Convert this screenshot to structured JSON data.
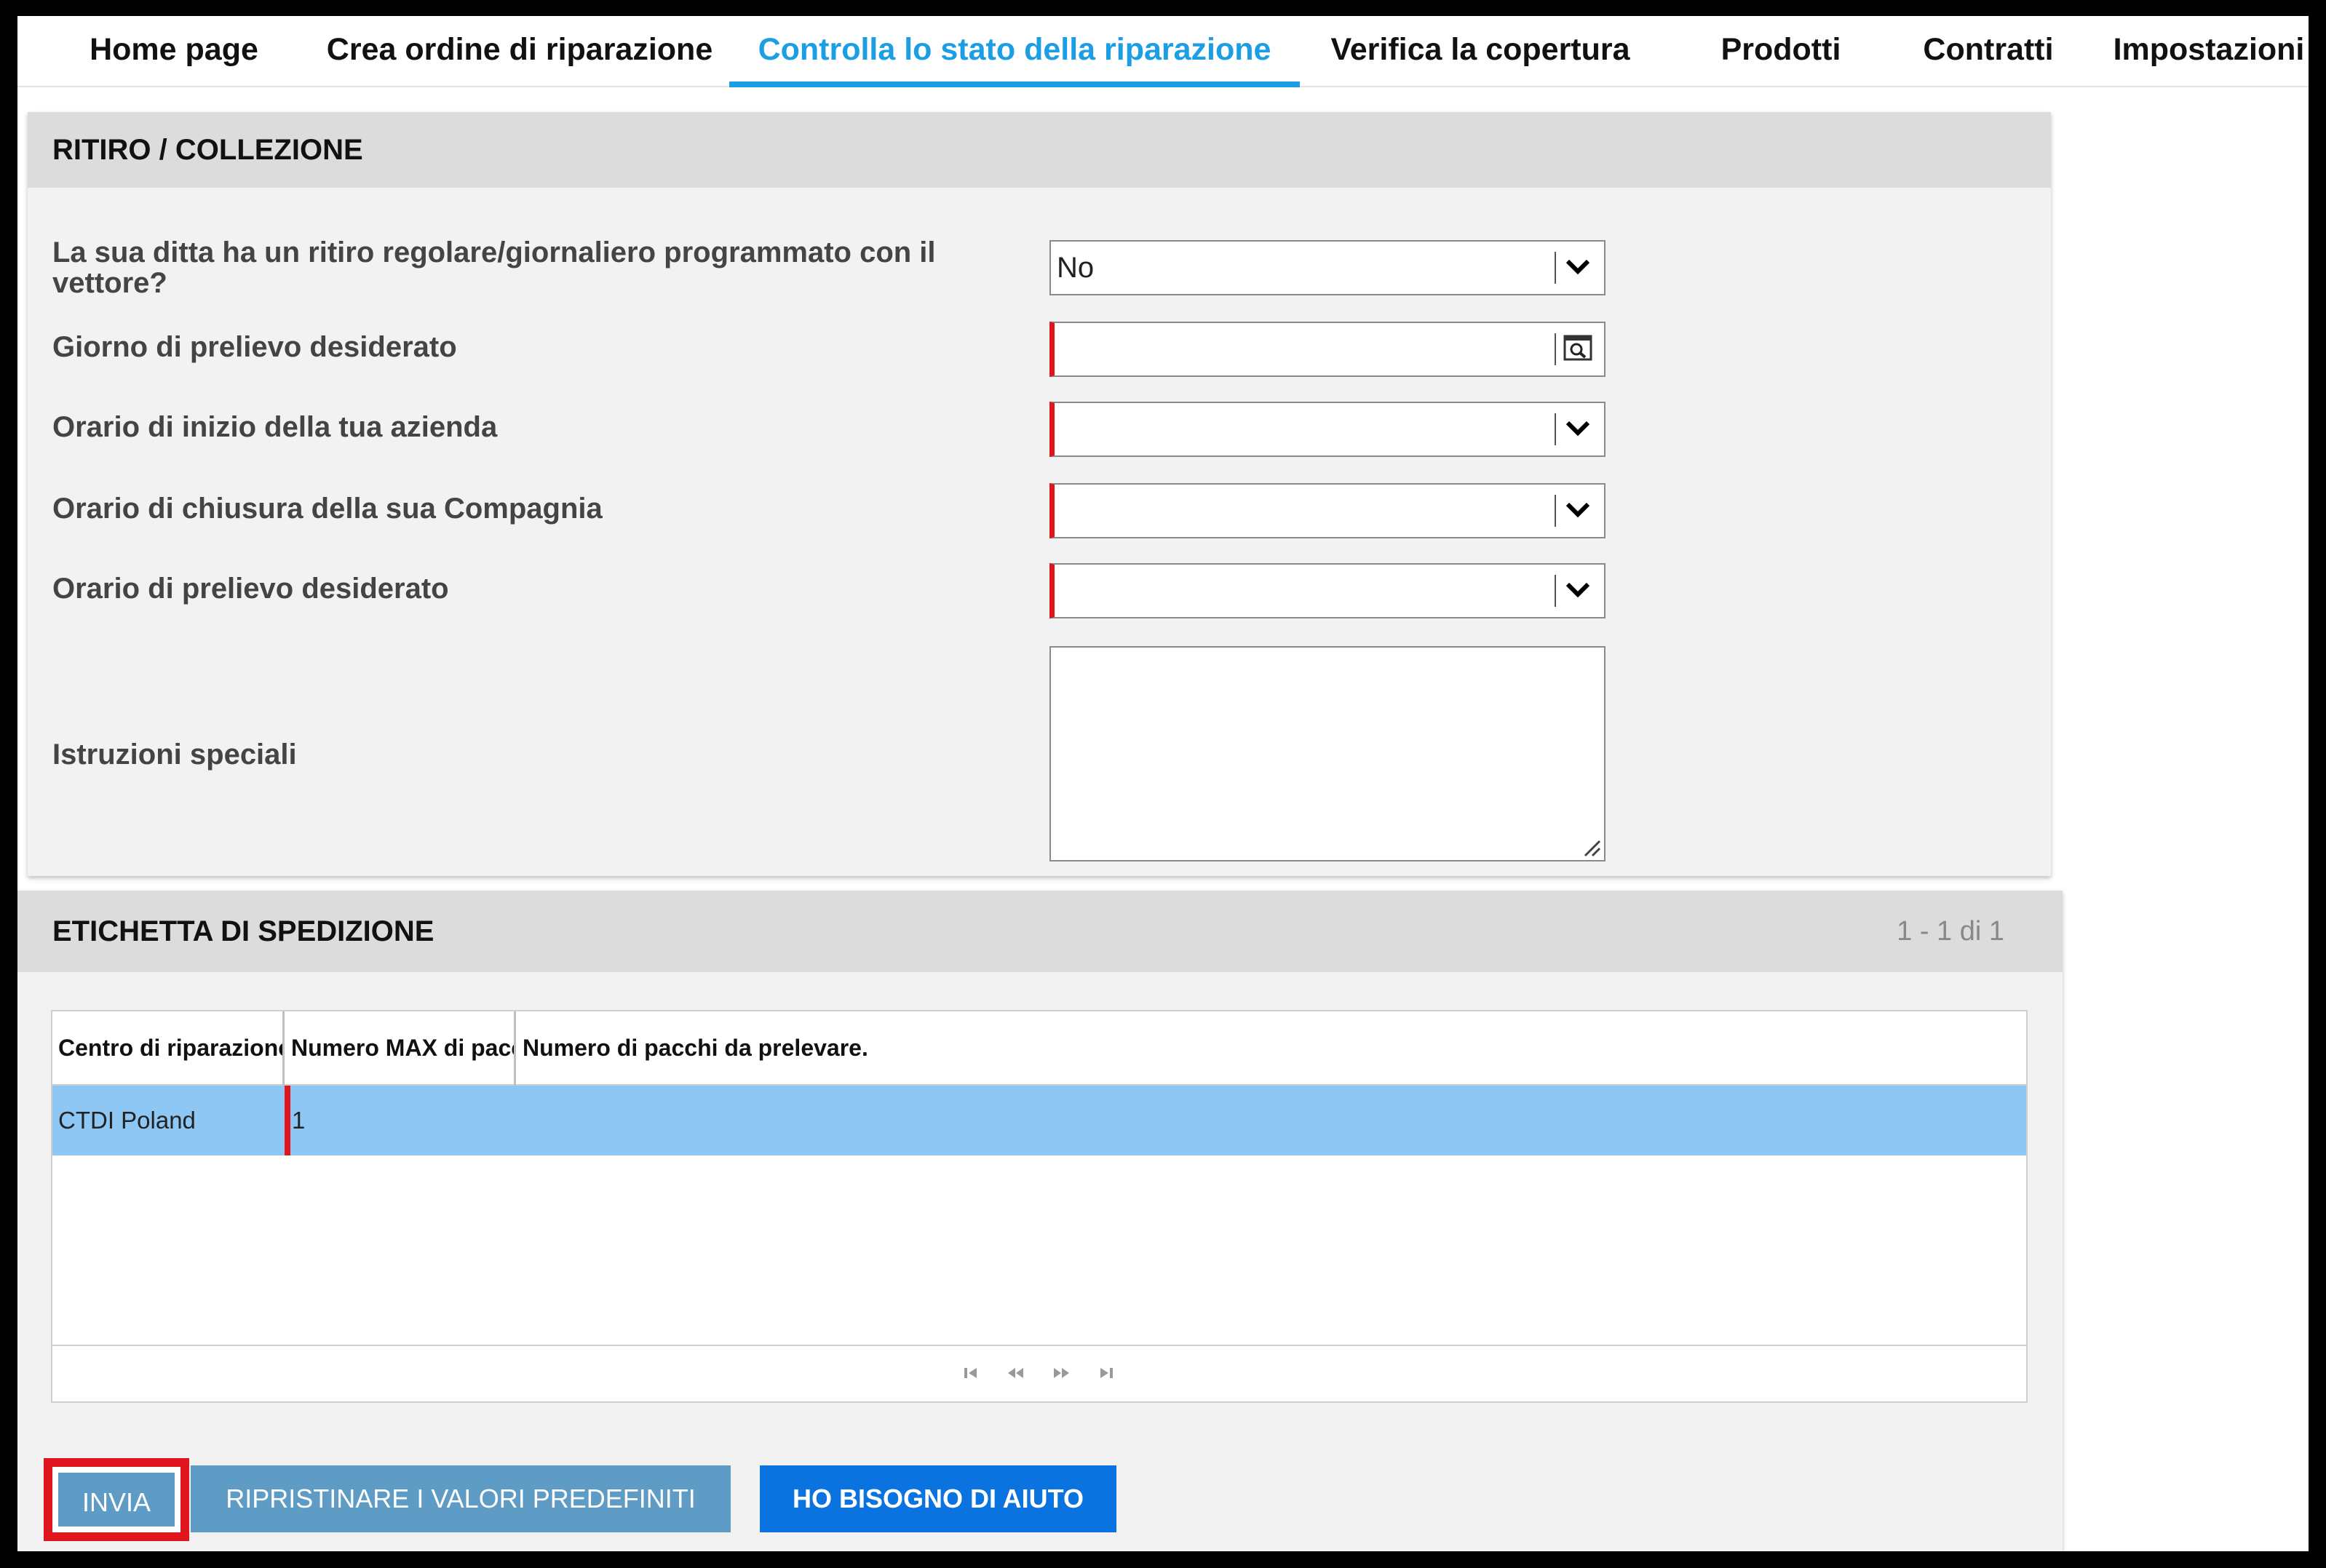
{
  "nav": {
    "tabs": [
      {
        "label": "Home page"
      },
      {
        "label": "Crea ordine di riparazione"
      },
      {
        "label": "Controlla lo stato della riparazione"
      },
      {
        "label": "Verifica la copertura"
      },
      {
        "label": "Prodotti"
      },
      {
        "label": "Contratti"
      },
      {
        "label": "Impostazioni"
      }
    ],
    "active_tab": "Controlla lo stato della riparazione"
  },
  "pickup": {
    "title": "RITIRO / COLLEZIONE",
    "fields": [
      {
        "label": "La sua ditta ha un ritiro regolare/giornaliero programmato con il vettore?",
        "value": "No",
        "type": "select",
        "required": false
      },
      {
        "label": "Giorno di prelievo desiderato",
        "value": "",
        "type": "date",
        "required": true
      },
      {
        "label": "Orario di inizio della tua azienda",
        "value": "",
        "type": "select",
        "required": true
      },
      {
        "label": "Orario di chiusura della sua Compagnia",
        "value": "",
        "type": "select",
        "required": true
      },
      {
        "label": "Orario di prelievo desiderato",
        "value": "",
        "type": "select",
        "required": true
      }
    ],
    "special_instructions": {
      "label": "Istruzioni speciali",
      "value": ""
    }
  },
  "shipping": {
    "title": "ETICHETTA DI SPEDIZIONE",
    "pager_text": "1 - 1 di 1",
    "columns": [
      "Centro di riparazione",
      "Numero MAX di pacchi",
      "Numero di pacchi da prelevare."
    ],
    "rows": [
      {
        "center": "CTDI Poland",
        "max_packages": "1",
        "packages_to_pick": ""
      }
    ]
  },
  "actions": {
    "submit": "INVIA",
    "reset": "RIPRISTINARE I VALORI PREDEFINITI",
    "help": "HO BISOGNO DI AIUTO"
  },
  "colors": {
    "accent": "#1b9ee3",
    "required": "#e0161e",
    "row_selected": "#8ec7f4",
    "button_primary": "#0a73e0",
    "button_secondary": "#5e9cc6"
  }
}
